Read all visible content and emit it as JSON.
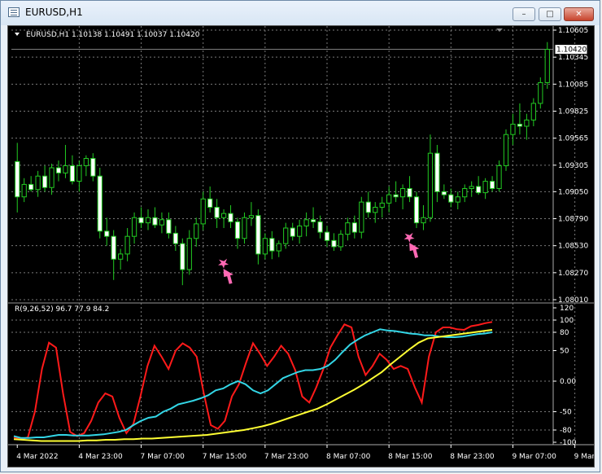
{
  "window": {
    "title": "EURUSD,H1",
    "min_glyph": "–",
    "max_glyph": "□",
    "close_glyph": "✕"
  },
  "main": {
    "label": "EURUSD,H1  1.10138 1.10491 1.10037 1.10420",
    "current_price": "1.10420",
    "price_range": [
      1.0801,
      1.10605
    ],
    "price_ticks": [
      "1.10605",
      "1.10345",
      "1.10085",
      "1.09825",
      "1.09565",
      "1.09305",
      "1.09050",
      "1.08790",
      "1.08530",
      "1.08270",
      "1.08010"
    ]
  },
  "indicator": {
    "label": "R(9,26,52) 96.7 77.9 84.2",
    "range": [
      -100,
      120
    ],
    "ticks": [
      "120",
      "100",
      "80",
      "50",
      "0.00",
      "-50",
      "-80",
      "-100"
    ],
    "tick_values": [
      120,
      100,
      80,
      50,
      0,
      -50,
      -80,
      -100
    ],
    "series": [
      {
        "color": "#ff1a1a",
        "values": [
          -92,
          -95,
          -92,
          -50,
          20,
          63,
          55,
          -20,
          -83,
          -90,
          -85,
          -65,
          -35,
          -20,
          -25,
          -60,
          -85,
          -70,
          -25,
          25,
          58,
          40,
          20,
          50,
          62,
          55,
          40,
          -20,
          -72,
          -78,
          -65,
          -25,
          -5,
          30,
          62,
          45,
          25,
          40,
          58,
          45,
          18,
          -25,
          -35,
          -10,
          20,
          55,
          75,
          93,
          88,
          40,
          10,
          25,
          45,
          35,
          20,
          25,
          20,
          -10,
          -35,
          40,
          80,
          88,
          88,
          85,
          84,
          90,
          92,
          95,
          97
        ]
      },
      {
        "color": "#33d6e6",
        "values": [
          -90,
          -93,
          -93,
          -92,
          -92,
          -90,
          -88,
          -88,
          -89,
          -89,
          -89,
          -88,
          -87,
          -85,
          -83,
          -80,
          -72,
          -65,
          -60,
          -58,
          -50,
          -45,
          -38,
          -35,
          -32,
          -28,
          -23,
          -15,
          -12,
          -5,
          0,
          -5,
          -15,
          -20,
          -15,
          -5,
          5,
          10,
          15,
          18,
          18,
          20,
          25,
          35,
          48,
          60,
          68,
          75,
          80,
          85,
          83,
          82,
          80,
          78,
          77,
          75,
          75,
          73,
          72,
          72,
          73,
          75,
          77,
          78,
          80
        ]
      },
      {
        "color": "#ffff33",
        "values": [
          -95,
          -96,
          -97,
          -98,
          -98,
          -98,
          -98,
          -98,
          -97,
          -97,
          -96,
          -96,
          -95,
          -95,
          -94,
          -94,
          -93,
          -92,
          -91,
          -90,
          -89,
          -88,
          -86,
          -84,
          -82,
          -80,
          -77,
          -74,
          -70,
          -65,
          -60,
          -55,
          -50,
          -45,
          -38,
          -30,
          -22,
          -14,
          -5,
          5,
          15,
          28,
          40,
          52,
          63,
          70,
          72,
          74,
          76,
          78,
          80,
          82,
          84
        ]
      }
    ]
  },
  "candles": [
    [
      1.0934,
      1.0952,
      1.0885,
      1.09
    ],
    [
      1.09,
      1.0918,
      1.0895,
      1.0912
    ],
    [
      1.0912,
      1.092,
      1.0905,
      1.0907
    ],
    [
      1.0907,
      1.0925,
      1.09,
      1.092
    ],
    [
      1.092,
      1.093,
      1.0905,
      1.0909
    ],
    [
      1.0909,
      1.0932,
      1.0902,
      1.0928
    ],
    [
      1.0928,
      1.0935,
      1.0915,
      1.0923
    ],
    [
      1.0923,
      1.095,
      1.0918,
      1.093
    ],
    [
      1.093,
      1.094,
      1.0912,
      1.0915
    ],
    [
      1.0915,
      1.0935,
      1.0905,
      1.093
    ],
    [
      1.093,
      1.094,
      1.092,
      1.0937
    ],
    [
      1.0937,
      1.0942,
      1.0915,
      1.092
    ],
    [
      1.092,
      1.0928,
      1.086,
      1.0867
    ],
    [
      1.0867,
      1.088,
      1.0853,
      1.0862
    ],
    [
      1.0862,
      1.0868,
      1.082,
      1.084
    ],
    [
      1.084,
      1.085,
      1.083,
      1.0845
    ],
    [
      1.0845,
      1.087,
      1.0838,
      1.0862
    ],
    [
      1.0862,
      1.0885,
      1.0855,
      1.088
    ],
    [
      1.088,
      1.089,
      1.087,
      1.0875
    ],
    [
      1.0875,
      1.0888,
      1.0868,
      1.088
    ],
    [
      1.088,
      1.089,
      1.087,
      1.0873
    ],
    [
      1.0873,
      1.0885,
      1.0865,
      1.0878
    ],
    [
      1.0878,
      1.0885,
      1.086,
      1.0865
    ],
    [
      1.0865,
      1.0872,
      1.0848,
      1.0855
    ],
    [
      1.0855,
      1.086,
      1.0815,
      1.083
    ],
    [
      1.083,
      1.0868,
      1.0825,
      1.086
    ],
    [
      1.086,
      1.088,
      1.0852,
      1.0874
    ],
    [
      1.0874,
      1.0905,
      1.0868,
      1.0898
    ],
    [
      1.0898,
      1.091,
      1.0885,
      1.089
    ],
    [
      1.089,
      1.0898,
      1.087,
      1.088
    ],
    [
      1.088,
      1.0888,
      1.087,
      1.0884
    ],
    [
      1.0884,
      1.0892,
      1.087,
      1.0876
    ],
    [
      1.0876,
      1.088,
      1.085,
      1.086
    ],
    [
      1.086,
      1.0885,
      1.0855,
      1.088
    ],
    [
      1.088,
      1.0895,
      1.0872,
      1.0882
    ],
    [
      1.0882,
      1.0888,
      1.0835,
      1.0845
    ],
    [
      1.0845,
      1.0865,
      1.084,
      1.086
    ],
    [
      1.086,
      1.0867,
      1.084,
      1.0848
    ],
    [
      1.0848,
      1.0858,
      1.0842,
      1.0855
    ],
    [
      1.0855,
      1.0875,
      1.085,
      1.087
    ],
    [
      1.087,
      1.0875,
      1.0858,
      1.0862
    ],
    [
      1.0862,
      1.0878,
      1.0855,
      1.0872
    ],
    [
      1.0872,
      1.0885,
      1.0862,
      1.0878
    ],
    [
      1.0878,
      1.089,
      1.087,
      1.0876
    ],
    [
      1.0876,
      1.0882,
      1.086,
      1.0866
    ],
    [
      1.0866,
      1.0872,
      1.0852,
      1.0858
    ],
    [
      1.0858,
      1.0865,
      1.0848,
      1.0852
    ],
    [
      1.0852,
      1.0868,
      1.0848,
      1.0864
    ],
    [
      1.0864,
      1.088,
      1.0858,
      1.0875
    ],
    [
      1.0875,
      1.0882,
      1.086,
      1.0866
    ],
    [
      1.0866,
      1.09,
      1.086,
      1.0895
    ],
    [
      1.0895,
      1.0905,
      1.088,
      1.0885
    ],
    [
      1.0885,
      1.0895,
      1.0875,
      1.089
    ],
    [
      1.089,
      1.09,
      1.088,
      1.0894
    ],
    [
      1.0894,
      1.091,
      1.0885,
      1.0902
    ],
    [
      1.0902,
      1.0915,
      1.0895,
      1.09
    ],
    [
      1.09,
      1.0912,
      1.0888,
      1.0908
    ],
    [
      1.0908,
      1.092,
      1.0895,
      1.09
    ],
    [
      1.09,
      1.0905,
      1.087,
      1.0875
    ],
    [
      1.0875,
      1.0892,
      1.0868,
      1.088
    ],
    [
      1.088,
      1.096,
      1.0876,
      1.0942
    ],
    [
      1.0942,
      1.095,
      1.0895,
      1.0905
    ],
    [
      1.0905,
      1.0912,
      1.0898,
      1.0902
    ],
    [
      1.0902,
      1.0908,
      1.089,
      1.0895
    ],
    [
      1.0895,
      1.0905,
      1.0888,
      1.09
    ],
    [
      1.09,
      1.0912,
      1.0895,
      1.0908
    ],
    [
      1.0908,
      1.0915,
      1.09,
      1.091
    ],
    [
      1.091,
      1.092,
      1.0902,
      1.0904
    ],
    [
      1.0904,
      1.0918,
      1.0898,
      1.0915
    ],
    [
      1.0915,
      1.092,
      1.0905,
      1.0908
    ],
    [
      1.0908,
      1.0935,
      1.0905,
      1.093
    ],
    [
      1.093,
      1.0965,
      1.0925,
      1.096
    ],
    [
      1.096,
      1.098,
      1.095,
      1.097
    ],
    [
      1.097,
      1.099,
      1.096,
      1.0968
    ],
    [
      1.0968,
      1.098,
      1.0955,
      1.0974
    ],
    [
      1.0974,
      1.0995,
      1.0968,
      1.099
    ],
    [
      1.099,
      1.1015,
      1.0985,
      1.101
    ],
    [
      1.101,
      1.1049,
      1.1004,
      1.1042
    ]
  ],
  "time_labels": [
    {
      "text": "4 Mar 2022",
      "index": 0
    },
    {
      "text": "4 Mar 23:00",
      "index": 9
    },
    {
      "text": "7 Mar 07:00",
      "index": 18
    },
    {
      "text": "7 Mar 15:00",
      "index": 27
    },
    {
      "text": "7 Mar 23:00",
      "index": 36
    },
    {
      "text": "8 Mar 07:00",
      "index": 45
    },
    {
      "text": "8 Mar 15:00",
      "index": 54
    },
    {
      "text": "8 Mar 23:00",
      "index": 63
    },
    {
      "text": "9 Mar 07:00",
      "index": 72
    },
    {
      "text": "9 Mar 15:00",
      "index": 81
    }
  ],
  "colors": {
    "bull": "#000000",
    "bear": "#ffffff",
    "wick": "#22cc22",
    "grid": "#7a7a7a",
    "marker": "#ff69b4"
  },
  "markers": [
    {
      "index": 30,
      "price": 1.0835
    },
    {
      "index": 57,
      "price": 1.086
    }
  ]
}
